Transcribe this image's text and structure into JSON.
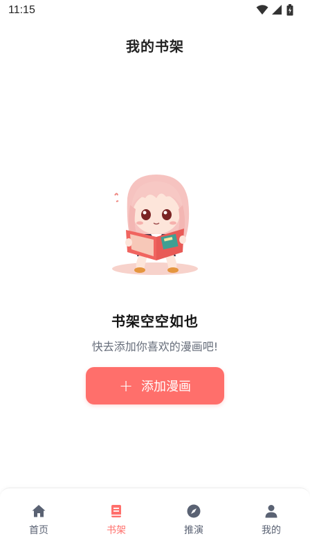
{
  "status_bar": {
    "time": "11:15",
    "icons": [
      "wifi-icon",
      "signal-icon",
      "battery-icon"
    ]
  },
  "header": {
    "title": "我的书架"
  },
  "empty_state": {
    "title": "书架空空如也",
    "subtitle": "快去添加你喜欢的漫画吧!",
    "button_label": "添加漫画",
    "button_icon": "plus-icon"
  },
  "bottom_nav": {
    "items": [
      {
        "label": "首页",
        "icon": "home-icon",
        "active": false
      },
      {
        "label": "书架",
        "icon": "book-icon",
        "active": true
      },
      {
        "label": "推演",
        "icon": "compass-icon",
        "active": false
      },
      {
        "label": "我的",
        "icon": "person-icon",
        "active": false
      }
    ]
  },
  "colors": {
    "accent": "#ff6f6b",
    "nav_inactive": "#5a6273",
    "subtitle": "#666d7a"
  }
}
